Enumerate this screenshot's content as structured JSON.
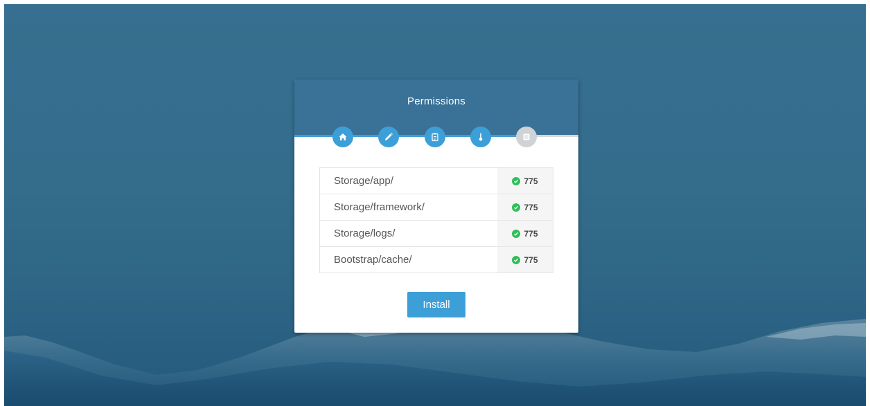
{
  "card": {
    "title": "Permissions"
  },
  "steps": [
    {
      "icon": "home-icon",
      "status": "completed"
    },
    {
      "icon": "pencil-icon",
      "status": "completed"
    },
    {
      "icon": "clipboard-icon",
      "status": "completed"
    },
    {
      "icon": "thermometer-icon",
      "status": "current"
    },
    {
      "icon": "list-icon",
      "status": "pending"
    }
  ],
  "permissions": [
    {
      "path": "Storage/app/",
      "value": "775",
      "status": "ok"
    },
    {
      "path": "Storage/framework/",
      "value": "775",
      "status": "ok"
    },
    {
      "path": "Storage/logs/",
      "value": "775",
      "status": "ok"
    },
    {
      "path": "Bootstrap/cache/",
      "value": "775",
      "status": "ok"
    }
  ],
  "actions": {
    "install_label": "Install"
  },
  "colors": {
    "background": "#346c8c",
    "header": "#3a7196",
    "accent": "#3d9fd8",
    "success": "#2fbf5a",
    "inactive_step": "#cfd3d6"
  }
}
